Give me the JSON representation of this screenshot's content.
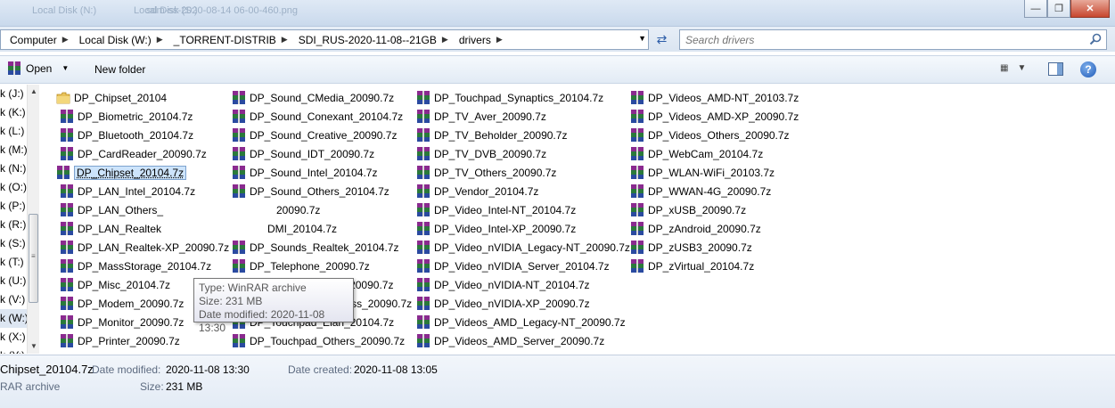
{
  "titlebar": {
    "ghost_items": [
      "Local Disk (N:)",
      "Local Disk (S:)",
      "sdm-ss-2020-08-14 06-00-460.png"
    ]
  },
  "address": {
    "crumbs": [
      "Computer",
      "Local Disk (W:)",
      "_TORRENT-DISTRIB",
      "SDI_RUS-2020-11-08--21GB",
      "drivers"
    ]
  },
  "search": {
    "placeholder": "Search drivers"
  },
  "toolbar": {
    "open_label": "Open",
    "new_folder_label": "New folder"
  },
  "nav": {
    "items": [
      "k (J:)",
      "k (K:)",
      "k (L:)",
      "k (M:)",
      "k (N:)",
      "k (O:)",
      "k (P:)",
      "k (R:)",
      "k (S:)",
      "k (T:)",
      "k (U:)",
      "k (V:)",
      "k (W:)",
      "k (X:)",
      "k (Y:)"
    ],
    "selected_index": 12
  },
  "files": {
    "col1": [
      "DP_Chipset_20104",
      "DP_Biometric_20104.7z",
      "DP_Bluetooth_20104.7z",
      "DP_CardReader_20090.7z",
      "DP_Chipset_20104.7z",
      "DP_LAN_Intel_20104.7z",
      "DP_LAN_Others_",
      "DP_LAN_Realtek",
      "DP_LAN_Realtek-XP_20090.7z",
      "DP_MassStorage_20104.7z",
      "DP_Misc_20104.7z",
      "DP_Modem_20090.7z",
      "DP_Monitor_20090.7z",
      "DP_Printer_20090.7z"
    ],
    "col2": [
      "DP_Sound_CMedia_20090.7z",
      "DP_Sound_Conexant_20104.7z",
      "DP_Sound_Creative_20090.7z",
      "DP_Sound_IDT_20090.7z",
      "DP_Sound_Intel_20104.7z",
      "DP_Sound_Others_20104.7z",
      "20090.7z",
      "DMI_20104.7z",
      "DP_Sounds_Realtek_20104.7z",
      "DP_Telephone_20090.7z",
      "DP_Touchpad_Alps_20090.7z",
      "DP_Touchpad_Cypress_20090.7z",
      "DP_Touchpad_Elan_20104.7z",
      "DP_Touchpad_Others_20090.7z"
    ],
    "col3": [
      "DP_Touchpad_Synaptics_20104.7z",
      "DP_TV_Aver_20090.7z",
      "DP_TV_Beholder_20090.7z",
      "DP_TV_DVB_20090.7z",
      "DP_TV_Others_20090.7z",
      "DP_Vendor_20104.7z",
      "DP_Video_Intel-NT_20104.7z",
      "DP_Video_Intel-XP_20090.7z",
      "DP_Video_nVIDIA_Legacy-NT_20090.7z",
      "DP_Video_nVIDIA_Server_20104.7z",
      "DP_Video_nVIDIA-NT_20104.7z",
      "DP_Video_nVIDIA-XP_20090.7z",
      "DP_Videos_AMD_Legacy-NT_20090.7z",
      "DP_Videos_AMD_Server_20090.7z"
    ],
    "col4": [
      "DP_Videos_AMD-NT_20103.7z",
      "DP_Videos_AMD-XP_20090.7z",
      "DP_Videos_Others_20090.7z",
      "DP_WebCam_20104.7z",
      "DP_WLAN-WiFi_20103.7z",
      "DP_WWAN-4G_20090.7z",
      "DP_xUSB_20090.7z",
      "DP_zAndroid_20090.7z",
      "DP_zUSB3_20090.7z",
      "DP_zVirtual_20104.7z"
    ],
    "selected": "DP_Chipset_20104.7z"
  },
  "tooltip": {
    "type": "Type: WinRAR archive",
    "size": "Size: 231 MB",
    "modified": "Date modified: 2020-11-08 13:30"
  },
  "details": {
    "name": "Chipset_20104.7z",
    "type": "RAR archive",
    "modified_label": "Date modified:",
    "modified_value": "2020-11-08 13:30",
    "created_label": "Date created:",
    "created_value": "2020-11-08 13:05",
    "size_label": "Size:",
    "size_value": "231 MB"
  }
}
